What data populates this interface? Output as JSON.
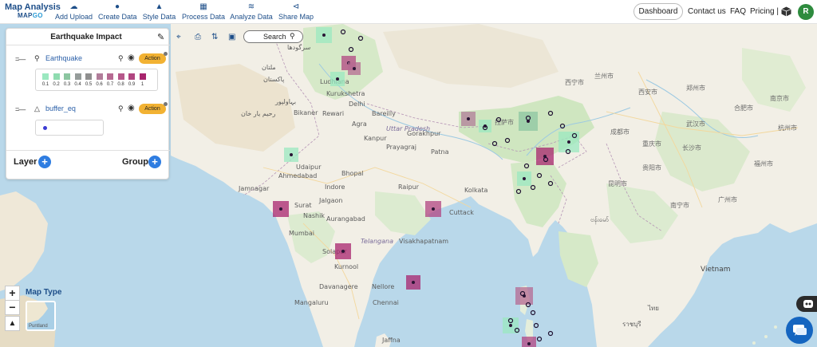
{
  "header": {
    "brand_line1": "Map Analysis",
    "brand_line2_a": "MAP",
    "brand_line2_b": "GO",
    "nav": [
      {
        "label": "Add Upload",
        "icon": "cloud-upload-icon"
      },
      {
        "label": "Create Data",
        "icon": "location-pin-icon"
      },
      {
        "label": "Style Data",
        "icon": "paint-bucket-icon"
      },
      {
        "label": "Process Data",
        "icon": "process-nodes-icon"
      },
      {
        "label": "Analyze Data",
        "icon": "analyze-chart-icon"
      },
      {
        "label": "Share Map",
        "icon": "share-icon"
      }
    ],
    "dashboard": "Dashboard",
    "contact": "Contact us",
    "faq": "FAQ",
    "pricing": "Pricing |",
    "avatar_letter": "R"
  },
  "panel": {
    "title": "Earthquake Impact",
    "layers": [
      {
        "name": "Earthquake",
        "action": "Action"
      },
      {
        "name": "buffer_eq",
        "action": "Action"
      }
    ],
    "legend_values": [
      "0.1",
      "0.2",
      "0.3",
      "0.4",
      "0.5",
      "0.6",
      "0.7",
      "0.8",
      "0.9",
      "1"
    ],
    "legend_colors": [
      "#9be8c0",
      "#8fdcb0",
      "#8cc6a1",
      "#959c9a",
      "#8f8f8f",
      "#b17d9a",
      "#b66a92",
      "#b6588b",
      "#b14681",
      "#a8246d"
    ],
    "point_color": "#3b3bd4",
    "add_layer": "Layer",
    "add_group": "Group"
  },
  "toolbar": {
    "tools": [
      "target-icon",
      "print-icon",
      "compare-icon",
      "comment-icon"
    ],
    "search_placeholder": "Search"
  },
  "map_controls": {
    "zoom_in": "+",
    "zoom_out": "−",
    "map_type_label": "Map Type",
    "thumb_label": "Puntland"
  },
  "map_labels": {
    "india": [
      "Ludhiana",
      "Kurukshetra",
      "Delhi",
      "Bikaner",
      "Rewari",
      "Agra",
      "Uttar Pradesh",
      "Kanpur",
      "Gorakhpur",
      "Bareilly",
      "Prayagraj",
      "Patna",
      "Udaipur",
      "Bhopal",
      "Ahmedabad",
      "Jamnagar",
      "Surat",
      "Jalgaon",
      "Indore",
      "Raipur",
      "Mumbai",
      "Aurangabad",
      "Nashik",
      "Solapur",
      "Kurnool",
      "Visakhapatnam",
      "Telangana",
      "Davanagere",
      "Nellore",
      "Mangaluru",
      "Chennai",
      "Kolkata",
      "Cuttack",
      "Jaffna"
    ],
    "pakistan": [
      "سرگودھا",
      "ملتان",
      "پاکستان",
      "بہاولپور",
      "رحیم یار خان"
    ],
    "east": [
      "ဗန်းမော်",
      "Vietnam",
      "ราชบุรี",
      "ไทย"
    ],
    "china": [
      "西宁市",
      "兰州市",
      "西安市",
      "郑州市",
      "武汉市",
      "长沙市",
      "贵阳市",
      "昆明市",
      "南宁市",
      "广州市",
      "成都市",
      "重庆市",
      "拉萨市",
      "合肥市",
      "南京市",
      "杭州市",
      "福州市"
    ]
  },
  "hexes": [
    {
      "name": "hex-punjab-north",
      "color": "#9be8c0"
    },
    {
      "name": "hex-punjab-1",
      "color": "#b14681"
    },
    {
      "name": "hex-delhi-1",
      "color": "#9be8c0"
    },
    {
      "name": "hex-kurukshetra",
      "color": "#b66a92"
    },
    {
      "name": "hex-nepal-1",
      "color": "#b17d9a"
    },
    {
      "name": "hex-nepal-2",
      "color": "#9be8c0"
    },
    {
      "name": "hex-northeast-1",
      "color": "#8cc6a1"
    },
    {
      "name": "hex-northeast-2",
      "color": "#9be8c0"
    },
    {
      "name": "hex-manipur",
      "color": "#a8246d"
    },
    {
      "name": "hex-myanmar",
      "color": "#9be8c0"
    },
    {
      "name": "hex-udaipur",
      "color": "#9be8c0"
    },
    {
      "name": "hex-surat",
      "color": "#a8246d"
    },
    {
      "name": "hex-cuttack",
      "color": "#b14681"
    },
    {
      "name": "hex-solapur",
      "color": "#a8246d"
    },
    {
      "name": "hex-bay",
      "color": "#a8246d"
    },
    {
      "name": "hex-andaman-1",
      "color": "#b66a92"
    },
    {
      "name": "hex-andaman-2",
      "color": "#9be8c0"
    },
    {
      "name": "hex-andaman-3",
      "color": "#b14681"
    }
  ]
}
